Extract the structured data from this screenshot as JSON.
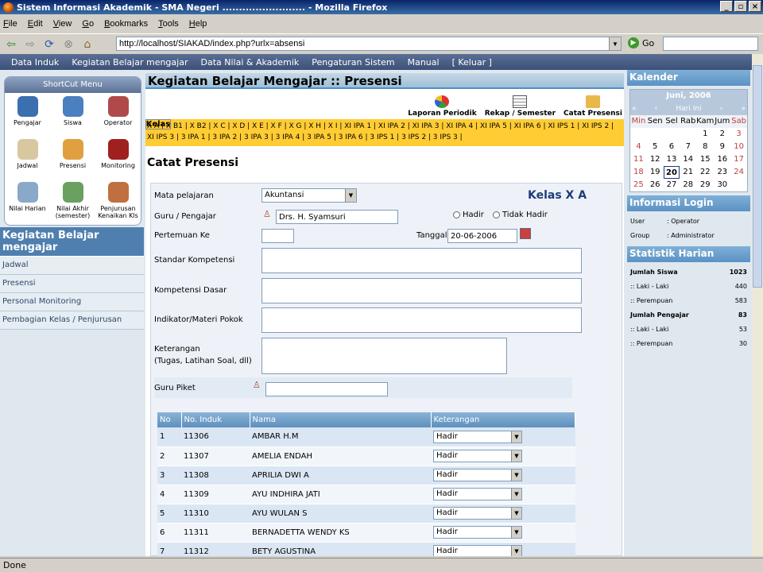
{
  "window": {
    "title": "Sistem Informasi Akademik - SMA Negeri ......................... - Mozilla Firefox"
  },
  "menubar": [
    "File",
    "Edit",
    "View",
    "Go",
    "Bookmarks",
    "Tools",
    "Help"
  ],
  "toolbar": {
    "url": "http://localhost/SIAKAD/index.php?urlx=absensi",
    "go_label": "Go"
  },
  "appnav": [
    "Data Induk",
    "Kegiatan Belajar mengajar",
    "Data Nilai & Akademik",
    "Pengaturan Sistem",
    "Manual",
    "[ Keluar ]"
  ],
  "shortcut": {
    "title": "ShortCut Menu",
    "items": [
      {
        "label": "Pengajar",
        "icon": "teacher-icon",
        "color": "#3a6fb0"
      },
      {
        "label": "Siswa",
        "icon": "student-icon",
        "color": "#4a7fc0"
      },
      {
        "label": "Operator",
        "icon": "operator-icon",
        "color": "#b04a4a"
      },
      {
        "label": "Jadwal",
        "icon": "clock-icon",
        "color": "#d8c8a0"
      },
      {
        "label": "Presensi",
        "icon": "calendar-icon",
        "color": "#e0a040"
      },
      {
        "label": "Monitoring",
        "icon": "book-icon",
        "color": "#a02020"
      },
      {
        "label": "Nilai Harian",
        "icon": "paper-icon",
        "color": "#8aa8c8"
      },
      {
        "label": "Nilai Akhir (semester)",
        "icon": "report-icon",
        "color": "#6aa060"
      },
      {
        "label": "Penjurusan Kenaikan Kls",
        "icon": "group-icon",
        "color": "#c07040"
      }
    ]
  },
  "leftmenu": {
    "title": "Kegiatan Belajar mengajar",
    "items": [
      "Jadwal",
      "Presensi",
      "Personal Monitoring",
      "Pembagian Kelas / Penjurusan"
    ]
  },
  "page": {
    "title": "Kegiatan Belajar Mengajar :: Presensi",
    "actions": [
      "Laporan Periodik",
      "Rekap / Semester",
      "Catat Presensi"
    ],
    "kelas_label": "Kelas",
    "kelas_links": "X A | X B1 | X B2 | X C | X D | X E | X F | X G | X H | X I | XI IPA 1 | XI IPA 2 | XI IPA 3 | XI IPA 4 | XI IPA 5 | XI IPA 6 | XI IPS 1 | XI IPS 2 | XI IPS 3 | 3 IPA 1 | 3 IPA 2 | 3 IPA 3 | 3 IPA 4 | 3 IPA 5 | 3 IPA 6 | 3 IPS 1 | 3 IPS 2 | 3 IPS 3 |",
    "section_title": "Catat Presensi"
  },
  "form": {
    "kelas_heading": "Kelas X A",
    "mapel_label": "Mata pelajaran",
    "mapel_value": "Akuntansi",
    "guru_label": "Guru / Pengajar",
    "guru_value": "Drs. H. Syamsuri",
    "hadir_label": "Hadir",
    "tidak_hadir_label": "Tidak Hadir",
    "pertemuan_label": "Pertemuan Ke",
    "pertemuan_value": "",
    "tanggal_label": "Tanggal",
    "tanggal_value": "20-06-2006",
    "standar_label": "Standar Kompetensi",
    "kompetensi_label": "Kompetensi Dasar",
    "indikator_label": "Indikator/Materi Pokok",
    "keterangan_label1": "Keterangan",
    "keterangan_label2": "(Tugas, Latihan Soal, dll)",
    "piket_label": "Guru Piket",
    "piket_value": ""
  },
  "attendance": {
    "columns": [
      "No",
      "No. Induk",
      "Nama",
      "Keterangan"
    ],
    "rows": [
      {
        "no": "1",
        "induk": "11306",
        "nama": "AMBAR H.M",
        "ket": "Hadir"
      },
      {
        "no": "2",
        "induk": "11307",
        "nama": "AMELIA ENDAH",
        "ket": "Hadir"
      },
      {
        "no": "3",
        "induk": "11308",
        "nama": "APRILIA DWI A",
        "ket": "Hadir"
      },
      {
        "no": "4",
        "induk": "11309",
        "nama": "AYU INDHIRA JATI",
        "ket": "Hadir"
      },
      {
        "no": "5",
        "induk": "11310",
        "nama": "AYU WULAN S",
        "ket": "Hadir"
      },
      {
        "no": "6",
        "induk": "11311",
        "nama": "BERNADETTA WENDY KS",
        "ket": "Hadir"
      },
      {
        "no": "7",
        "induk": "11312",
        "nama": "BETY AGUSTINA",
        "ket": "Hadir"
      }
    ]
  },
  "calendar": {
    "title": "Kalender",
    "month": "Juni, 2006",
    "today_label": "Hari Ini",
    "nav": [
      "«",
      "‹",
      "›",
      "»"
    ],
    "days": [
      "Min",
      "Sen",
      "Sel",
      "Rab",
      "Kam",
      "Jum",
      "Sab"
    ],
    "cells": [
      "",
      "",
      "",
      "",
      "1",
      "2",
      "3",
      "4",
      "5",
      "6",
      "7",
      "8",
      "9",
      "10",
      "11",
      "12",
      "13",
      "14",
      "15",
      "16",
      "17",
      "18",
      "19",
      "20",
      "21",
      "22",
      "23",
      "24",
      "25",
      "26",
      "27",
      "28",
      "29",
      "30",
      ""
    ],
    "today": "20"
  },
  "login": {
    "title": "Informasi Login",
    "user_label": "User",
    "user_value": ": Operator",
    "group_label": "Group",
    "group_value": ": Administrator"
  },
  "stats": {
    "title": "Statistik Harian",
    "rows": [
      {
        "label": "Jumlah Siswa",
        "value": "1023",
        "bold": true
      },
      {
        "label": ":: Laki - Laki",
        "value": "440",
        "bold": false
      },
      {
        "label": ":: Perempuan",
        "value": "583",
        "bold": false
      },
      {
        "label": "Jumlah Pengajar",
        "value": "83",
        "bold": true
      },
      {
        "label": ":: Laki - Laki",
        "value": "53",
        "bold": false
      },
      {
        "label": ":: Perempuan",
        "value": "30",
        "bold": false
      }
    ]
  },
  "status": "Done"
}
